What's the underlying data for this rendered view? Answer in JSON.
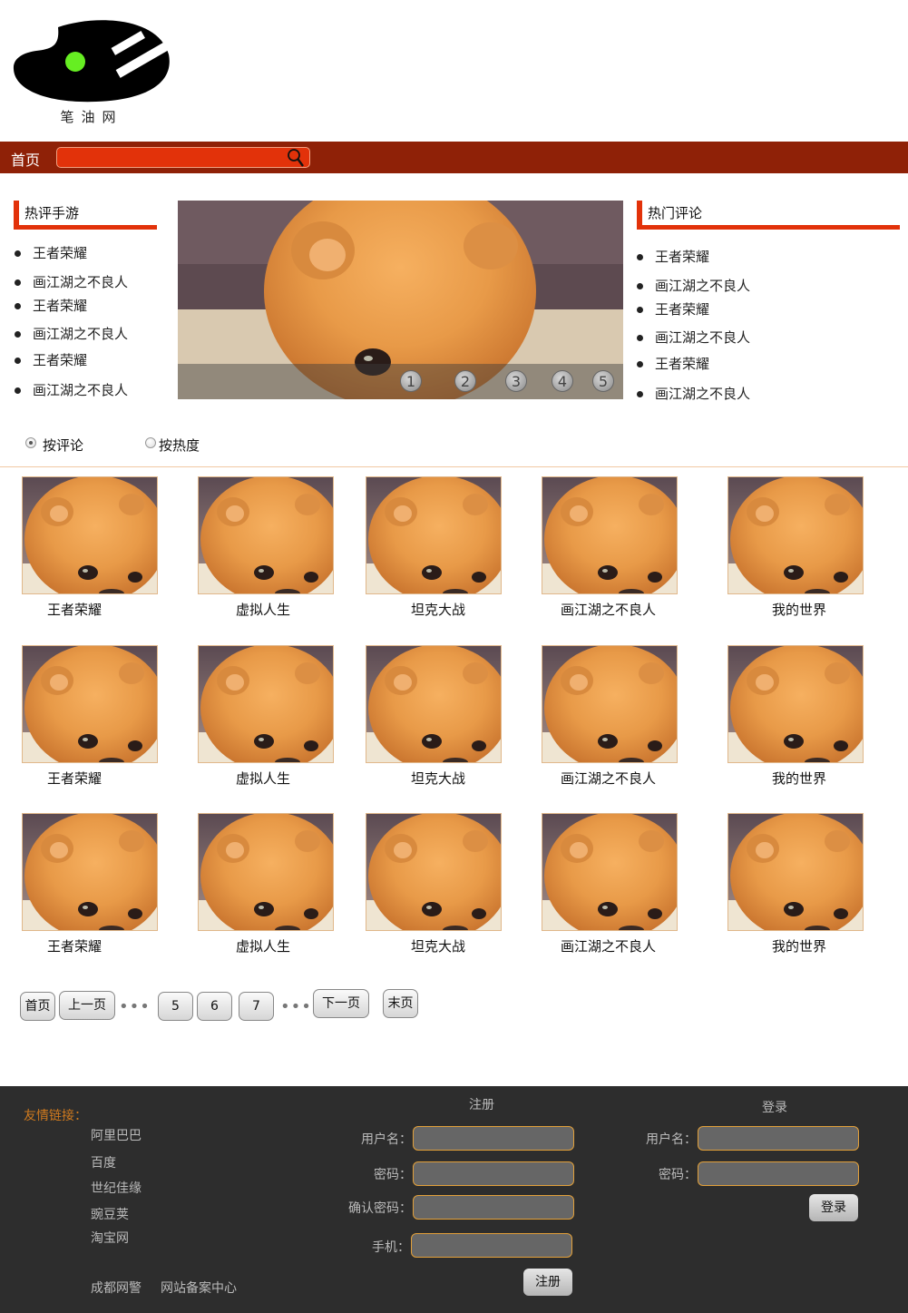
{
  "site": {
    "logo_text": "笔油网"
  },
  "nav": {
    "home_label": "首页",
    "search_value": ""
  },
  "hot_games": {
    "title": "热评手游",
    "items": [
      "王者荣耀",
      "画江湖之不良人",
      "王者荣耀",
      "画江湖之不良人",
      "王者荣耀",
      "画江湖之不良人"
    ]
  },
  "hot_comments": {
    "title": "热门评论",
    "items": [
      "王者荣耀",
      "画江湖之不良人",
      "王者荣耀",
      "画江湖之不良人",
      "王者荣耀",
      "画江湖之不良人"
    ]
  },
  "banner": {
    "dots": [
      "1",
      "2",
      "3",
      "4",
      "5"
    ]
  },
  "sort": {
    "options": [
      {
        "label": "按评论",
        "checked": true
      },
      {
        "label": "按热度",
        "checked": false
      }
    ]
  },
  "grid": {
    "rows": [
      [
        "王者荣耀",
        "虚拟人生",
        "坦克大战",
        "画江湖之不良人",
        "我的世界"
      ],
      [
        "王者荣耀",
        "虚拟人生",
        "坦克大战",
        "画江湖之不良人",
        "我的世界"
      ],
      [
        "王者荣耀",
        "虚拟人生",
        "坦克大战",
        "画江湖之不良人",
        "我的世界"
      ]
    ]
  },
  "pagination": {
    "first": "首页",
    "prev": "上一页",
    "pages": [
      "5",
      "6",
      "7"
    ],
    "next": "下一页",
    "last": "末页",
    "ellipsis": "•••"
  },
  "footer": {
    "friend_title": "友情链接：",
    "friend_links": [
      "阿里巴巴",
      "百度",
      "世纪佳缘",
      "豌豆荚",
      "淘宝网"
    ],
    "bottom_links": [
      "成都网警",
      "网站备案中心"
    ],
    "register": {
      "title": "注册",
      "labels": [
        "用户名：",
        "密码：",
        "确认密码：",
        "手机："
      ],
      "button": "注册"
    },
    "login": {
      "title": "登录",
      "labels": [
        "用户名：",
        "密码："
      ],
      "button": "登录"
    }
  },
  "colors": {
    "nav_bg": "#8f2107",
    "accent": "#e2320a",
    "footer_bg": "#2d2d2d",
    "link_orange": "#d07a1e"
  }
}
